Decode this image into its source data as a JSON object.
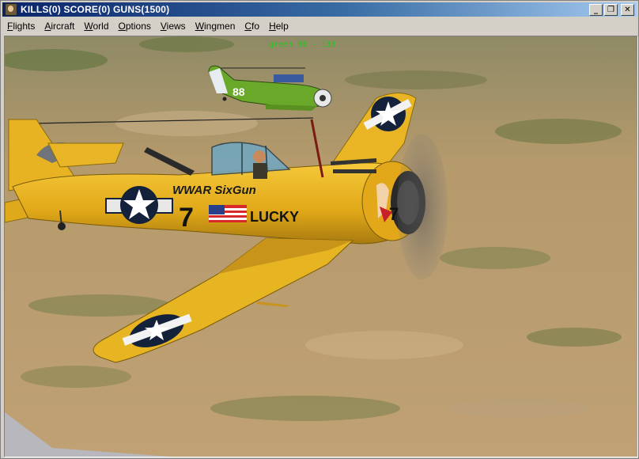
{
  "window": {
    "title": "KILLS(0) SCORE(0) GUNS(1500)",
    "minimize_glyph": "_",
    "restore_glyph": "❐",
    "close_glyph": "✕"
  },
  "menu": [
    {
      "label": "Flights",
      "mnemonic": "F",
      "rest": "lights"
    },
    {
      "label": "Aircraft",
      "mnemonic": "A",
      "rest": "ircraft"
    },
    {
      "label": "World",
      "mnemonic": "W",
      "rest": "orld"
    },
    {
      "label": "Options",
      "mnemonic": "O",
      "rest": "ptions"
    },
    {
      "label": "Views",
      "mnemonic": "V",
      "rest": "iews"
    },
    {
      "label": "Wingmen",
      "mnemonic": "W",
      "rest": "ingmen"
    },
    {
      "label": "Cfo",
      "mnemonic": "C",
      "rest": "fo"
    },
    {
      "label": "Help",
      "mnemonic": "H",
      "rest": "elp"
    }
  ],
  "hud": {
    "target_readout": "green 88 - 133"
  },
  "scene": {
    "main_aircraft": {
      "nose_art": "WWAR SixGun",
      "number": "7",
      "name": "LUCKY",
      "color": "#e6b21e"
    },
    "wingman_aircraft": {
      "number": "88",
      "color": "#6aa82a"
    },
    "ground_color": "#b89e72"
  }
}
